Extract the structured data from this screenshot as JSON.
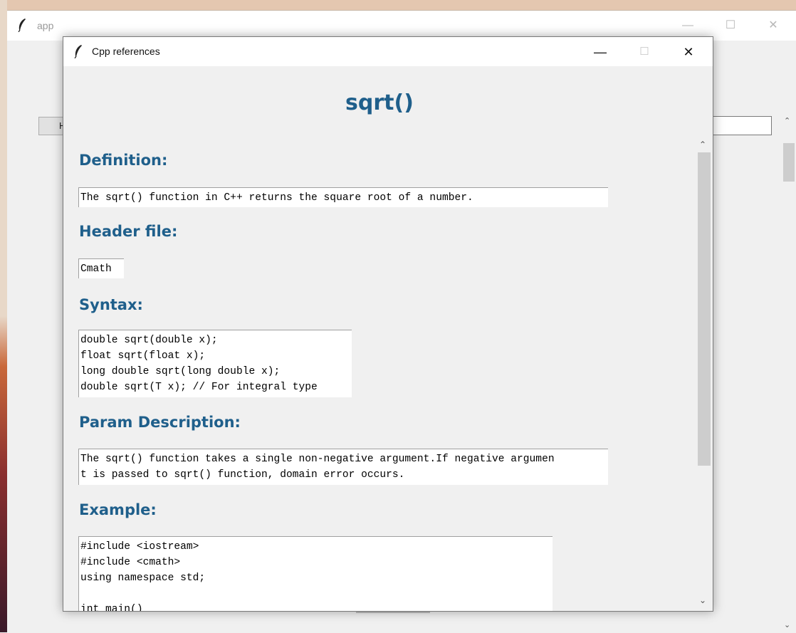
{
  "background_window": {
    "title": "app",
    "button_label": "H",
    "controls": {
      "minimize": "—",
      "maximize": "☐",
      "close": "✕"
    }
  },
  "dialog": {
    "title": "Cpp references",
    "controls": {
      "minimize": "—",
      "maximize": "☐",
      "close": "✕"
    }
  },
  "page": {
    "heading": "sqrt()",
    "sections": {
      "definition": {
        "label": "Definition:",
        "text": "The sqrt() function in C++ returns the square root of a number."
      },
      "header_file": {
        "label": "Header file:",
        "text": "Cmath"
      },
      "syntax": {
        "label": "Syntax:",
        "text": "double sqrt(double x);\nfloat sqrt(float x);\nlong double sqrt(long double x);\ndouble sqrt(T x); // For integral type"
      },
      "param_description": {
        "label": "Param Description:",
        "text": "The sqrt() function takes a single non-negative argument.If negative argumen\nt is passed to sqrt() function, domain error occurs."
      },
      "example": {
        "label": "Example:",
        "text": "#include <iostream>\n#include <cmath>\nusing namespace std;\n\nint main()"
      }
    }
  },
  "icons": [
    "feather-icon",
    "scroll-up-arrow-icon",
    "scroll-down-arrow-icon"
  ]
}
